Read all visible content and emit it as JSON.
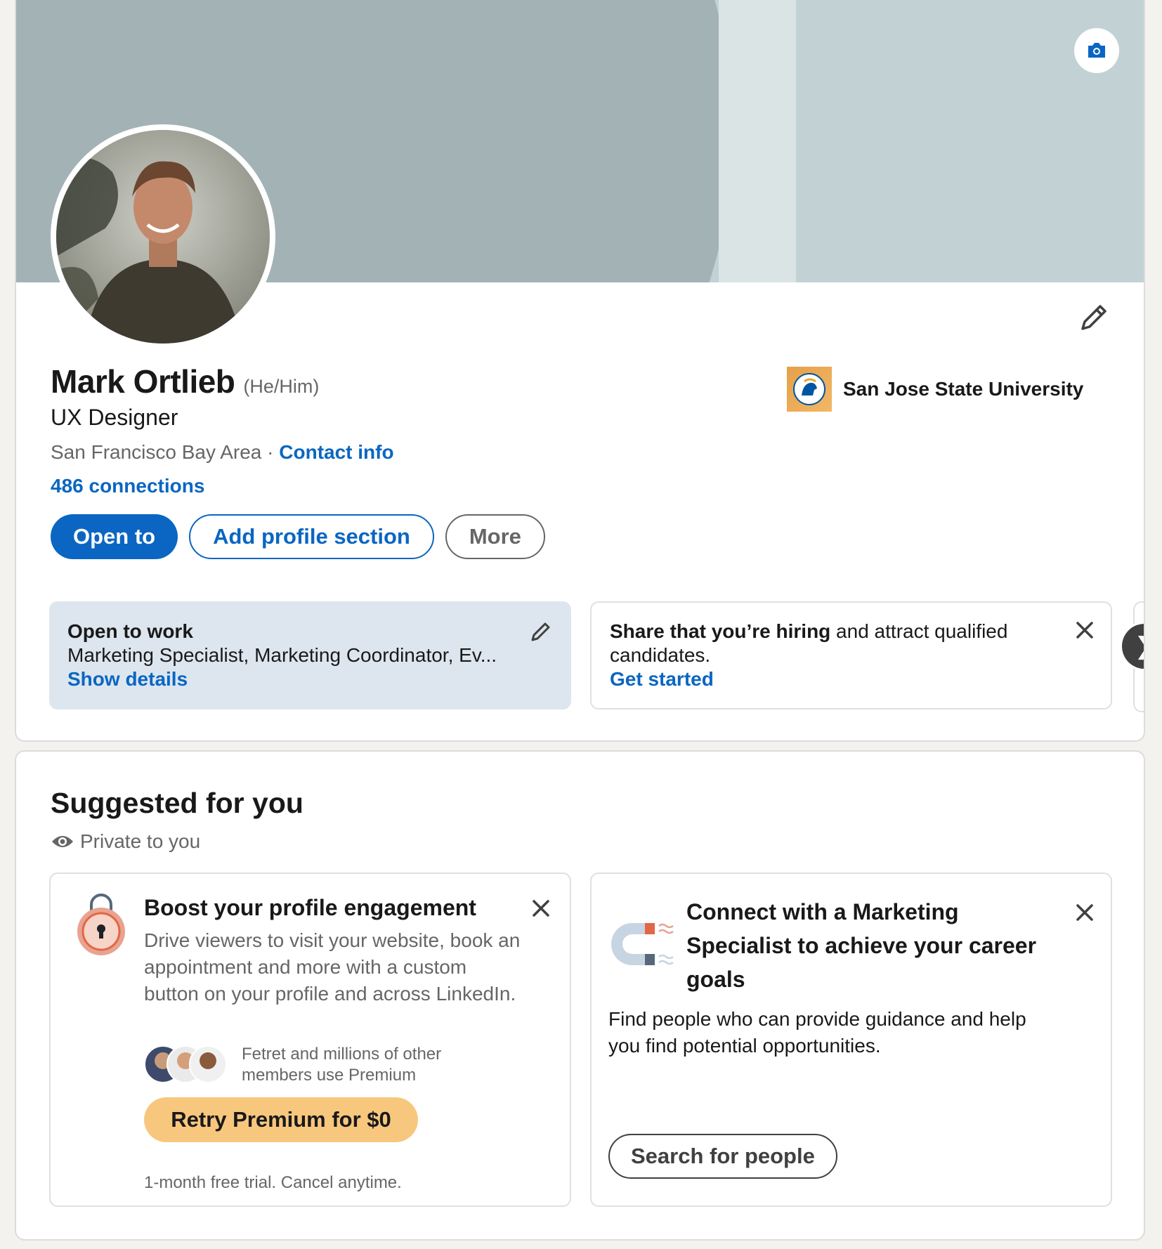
{
  "profile": {
    "name": "Mark Ortlieb",
    "pronouns": "(He/Him)",
    "headline": "UX Designer",
    "location": "San Francisco Bay Area",
    "separator": "·",
    "contact_info": "Contact info",
    "connections": "486 connections",
    "education": "San Jose State University"
  },
  "actions": {
    "open_to": "Open to",
    "add_section": "Add profile section",
    "more": "More"
  },
  "open_to_work": {
    "title": "Open to work",
    "roles": "Marketing Specialist, Marketing Coordinator, Ev...",
    "link": "Show details"
  },
  "hiring": {
    "bold": "Share that you’re hiring",
    "rest": " and attract qualified candidates.",
    "link": "Get started"
  },
  "suggested": {
    "title": "Suggested for you",
    "privacy": "Private to you",
    "boost": {
      "title": "Boost your profile engagement",
      "description": "Drive viewers to visit your website, book an appointment and more with a custom button on your profile and across LinkedIn.",
      "social_proof": "Fetret and millions of other members use Premium",
      "cta": "Retry Premium for $0",
      "footnote": "1-month free trial. Cancel anytime."
    },
    "connect": {
      "title": "Connect with a Marketing Specialist to achieve your career goals",
      "description": "Find people who can provide guidance and help you find potential opportunities.",
      "cta": "Search for people"
    }
  },
  "colors": {
    "brand": "#0a66c2",
    "premium": "#f8c77e",
    "open_to_work_bg": "#dde6ef"
  }
}
